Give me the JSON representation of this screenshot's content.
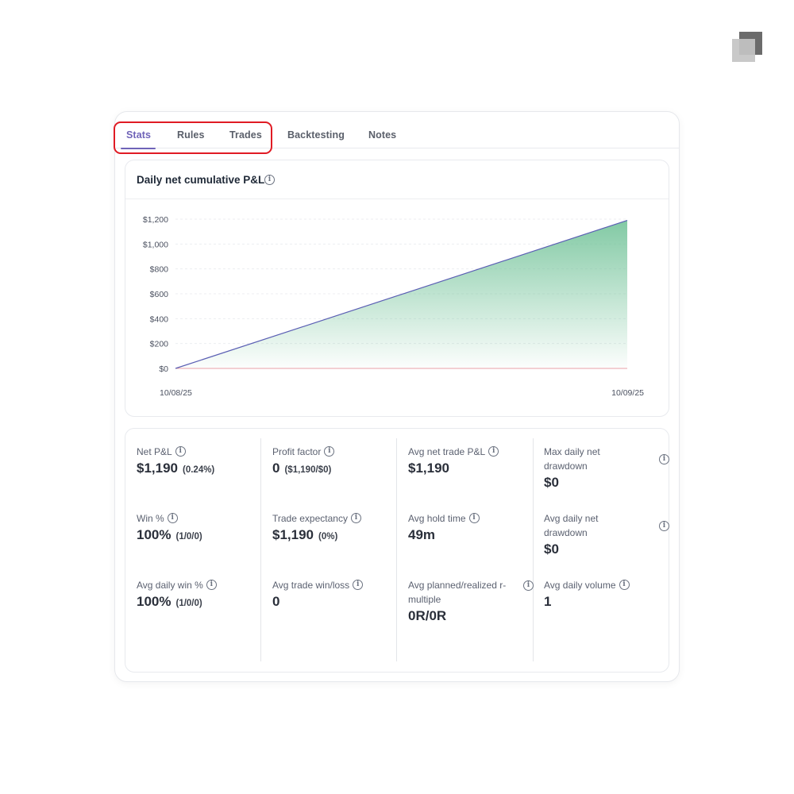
{
  "tabs": [
    {
      "label": "Stats",
      "active": true
    },
    {
      "label": "Rules",
      "active": false
    },
    {
      "label": "Trades",
      "active": false
    },
    {
      "label": "Backtesting",
      "active": false
    },
    {
      "label": "Notes",
      "active": false
    }
  ],
  "chart": {
    "title": "Daily net cumulative P&L"
  },
  "chart_data": {
    "type": "area",
    "title": "Daily net cumulative P&L",
    "x": [
      "10/08/25",
      "10/09/25"
    ],
    "values": [
      0,
      1190
    ],
    "ylim": [
      0,
      1200
    ],
    "yticks": [
      "$0",
      "$200",
      "$400",
      "$600",
      "$800",
      "$1,000",
      "$1,200"
    ],
    "ytick_values": [
      0,
      200,
      400,
      600,
      800,
      1000,
      1200
    ],
    "grid": true,
    "colors": {
      "line": "#5b5fb4",
      "fill": "#6cc094",
      "zero_line": "#e8a0a8"
    }
  },
  "stats": {
    "net_pl": {
      "label": "Net P&L",
      "value": "$1,190",
      "sub": "(0.24%)"
    },
    "profit_factor": {
      "label": "Profit factor",
      "value": "0",
      "sub": "($1,190/$0)"
    },
    "avg_net_trade_pl": {
      "label": "Avg net trade P&L",
      "value": "$1,190"
    },
    "max_daily_drawdown": {
      "label_line1": "Max daily net",
      "label_line2": "drawdown",
      "value": "$0"
    },
    "win_pct": {
      "label": "Win %",
      "value": "100%",
      "sub": "(1/0/0)"
    },
    "trade_expectancy": {
      "label": "Trade expectancy",
      "value": "$1,190",
      "sub": "(0%)"
    },
    "avg_hold_time": {
      "label": "Avg hold time",
      "value": "49m"
    },
    "avg_daily_drawdown": {
      "label_line1": "Avg daily net",
      "label_line2": "drawdown",
      "value": "$0"
    },
    "avg_daily_win_pct": {
      "label": "Avg daily win %",
      "value": "100%",
      "sub": "(1/0/0)"
    },
    "avg_trade_win_loss": {
      "label": "Avg trade win/loss",
      "value": "0"
    },
    "avg_r_multiple": {
      "label_line1": "Avg planned/realized r-",
      "label_line2": "multiple",
      "value": "0R/0R"
    },
    "avg_daily_volume": {
      "label": "Avg daily volume",
      "value": "1"
    }
  },
  "colors": {
    "accent": "#6f63b8",
    "highlight": "#e01b24"
  }
}
